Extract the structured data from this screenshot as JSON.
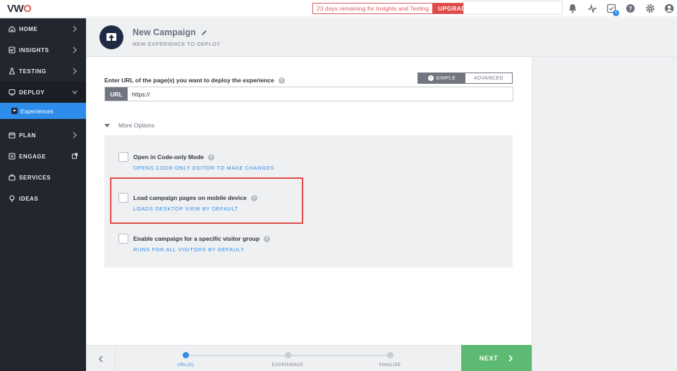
{
  "app": {
    "logo_text_left": "VW",
    "logo_text_o": "O"
  },
  "topbar": {
    "trial_message": "23 days remaining for Insights and Testing",
    "upgrade_label": "UPGRADE",
    "icons": [
      "bell-icon",
      "activity-icon",
      "checklist-icon",
      "help-icon",
      "gear-icon",
      "user-icon"
    ],
    "checklist_badge": "i"
  },
  "sidebar": {
    "items": [
      {
        "label": "HOME",
        "icon": "home-icon"
      },
      {
        "label": "INSIGHTS",
        "icon": "insights-icon"
      },
      {
        "label": "TESTING",
        "icon": "flask-icon"
      },
      {
        "label": "DEPLOY",
        "icon": "deploy-icon"
      },
      {
        "label": "PLAN",
        "icon": "calendar-icon"
      },
      {
        "label": "ENGAGE",
        "icon": "engage-icon"
      },
      {
        "label": "SERVICES",
        "icon": "briefcase-icon"
      },
      {
        "label": "IDEAS",
        "icon": "bulb-icon"
      }
    ],
    "sub_item": {
      "label": "Experiences",
      "icon": "experiences-icon"
    }
  },
  "header": {
    "title": "New Campaign",
    "subtitle": "NEW EXPERIENCE TO DEPLOY"
  },
  "form": {
    "url_label": "Enter URL of the page(s) you want to deploy the experience",
    "help_glyph": "?",
    "mode_simple": "SIMPLE",
    "mode_advanced": "ADVANCED",
    "url_prefix": "URL",
    "url_value": "https://",
    "more_options": "More Options",
    "options": [
      {
        "title": "Open in Code-only Mode",
        "desc": "OPENS CODE-ONLY EDITOR TO MAKE CHANGES",
        "checked": false
      },
      {
        "title": "Load campaign pages on mobile device",
        "desc": "LOADS DESKTOP VIEW BY DEFAULT",
        "checked": false
      },
      {
        "title": "Enable campaign for a specific visitor group",
        "desc": "RUNS FOR ALL VISITORS BY DEFAULT",
        "checked": false
      }
    ]
  },
  "wizard": {
    "steps": [
      "URL(S)",
      "EXPERIENCE",
      "FINALIZE"
    ],
    "current_step": 0,
    "next_label": "NEXT"
  },
  "colors": {
    "accent": "#2e8cea",
    "sidebar": "#22262f",
    "next": "#5cba72",
    "highlight": "#e04a4a"
  }
}
